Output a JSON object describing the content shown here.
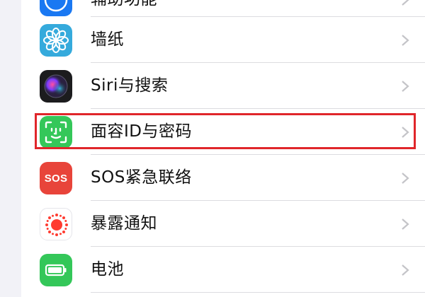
{
  "settings_list": {
    "items": [
      {
        "id": "accessibility",
        "label": "辅助功能",
        "icon": "accessibility-icon",
        "color": "#1a78f2"
      },
      {
        "id": "wallpaper",
        "label": "墙纸",
        "icon": "flower-icon",
        "color": "#35aadc"
      },
      {
        "id": "siri",
        "label": "Siri与搜索",
        "icon": "siri-icon",
        "color": "#1c1c1e"
      },
      {
        "id": "face-id",
        "label": "面容ID与密码",
        "icon": "face-id-icon",
        "color": "#34c759"
      },
      {
        "id": "sos",
        "label": "SOS紧急联络",
        "icon": "sos-icon",
        "icon_text": "SOS",
        "color": "#e8443a"
      },
      {
        "id": "exposure",
        "label": "暴露通知",
        "icon": "exposure-icon",
        "color": "#ff3b30"
      },
      {
        "id": "battery",
        "label": "电池",
        "icon": "battery-icon",
        "color": "#34c759"
      }
    ]
  },
  "highlight": {
    "target": "face-id",
    "color": "#e0262a"
  }
}
